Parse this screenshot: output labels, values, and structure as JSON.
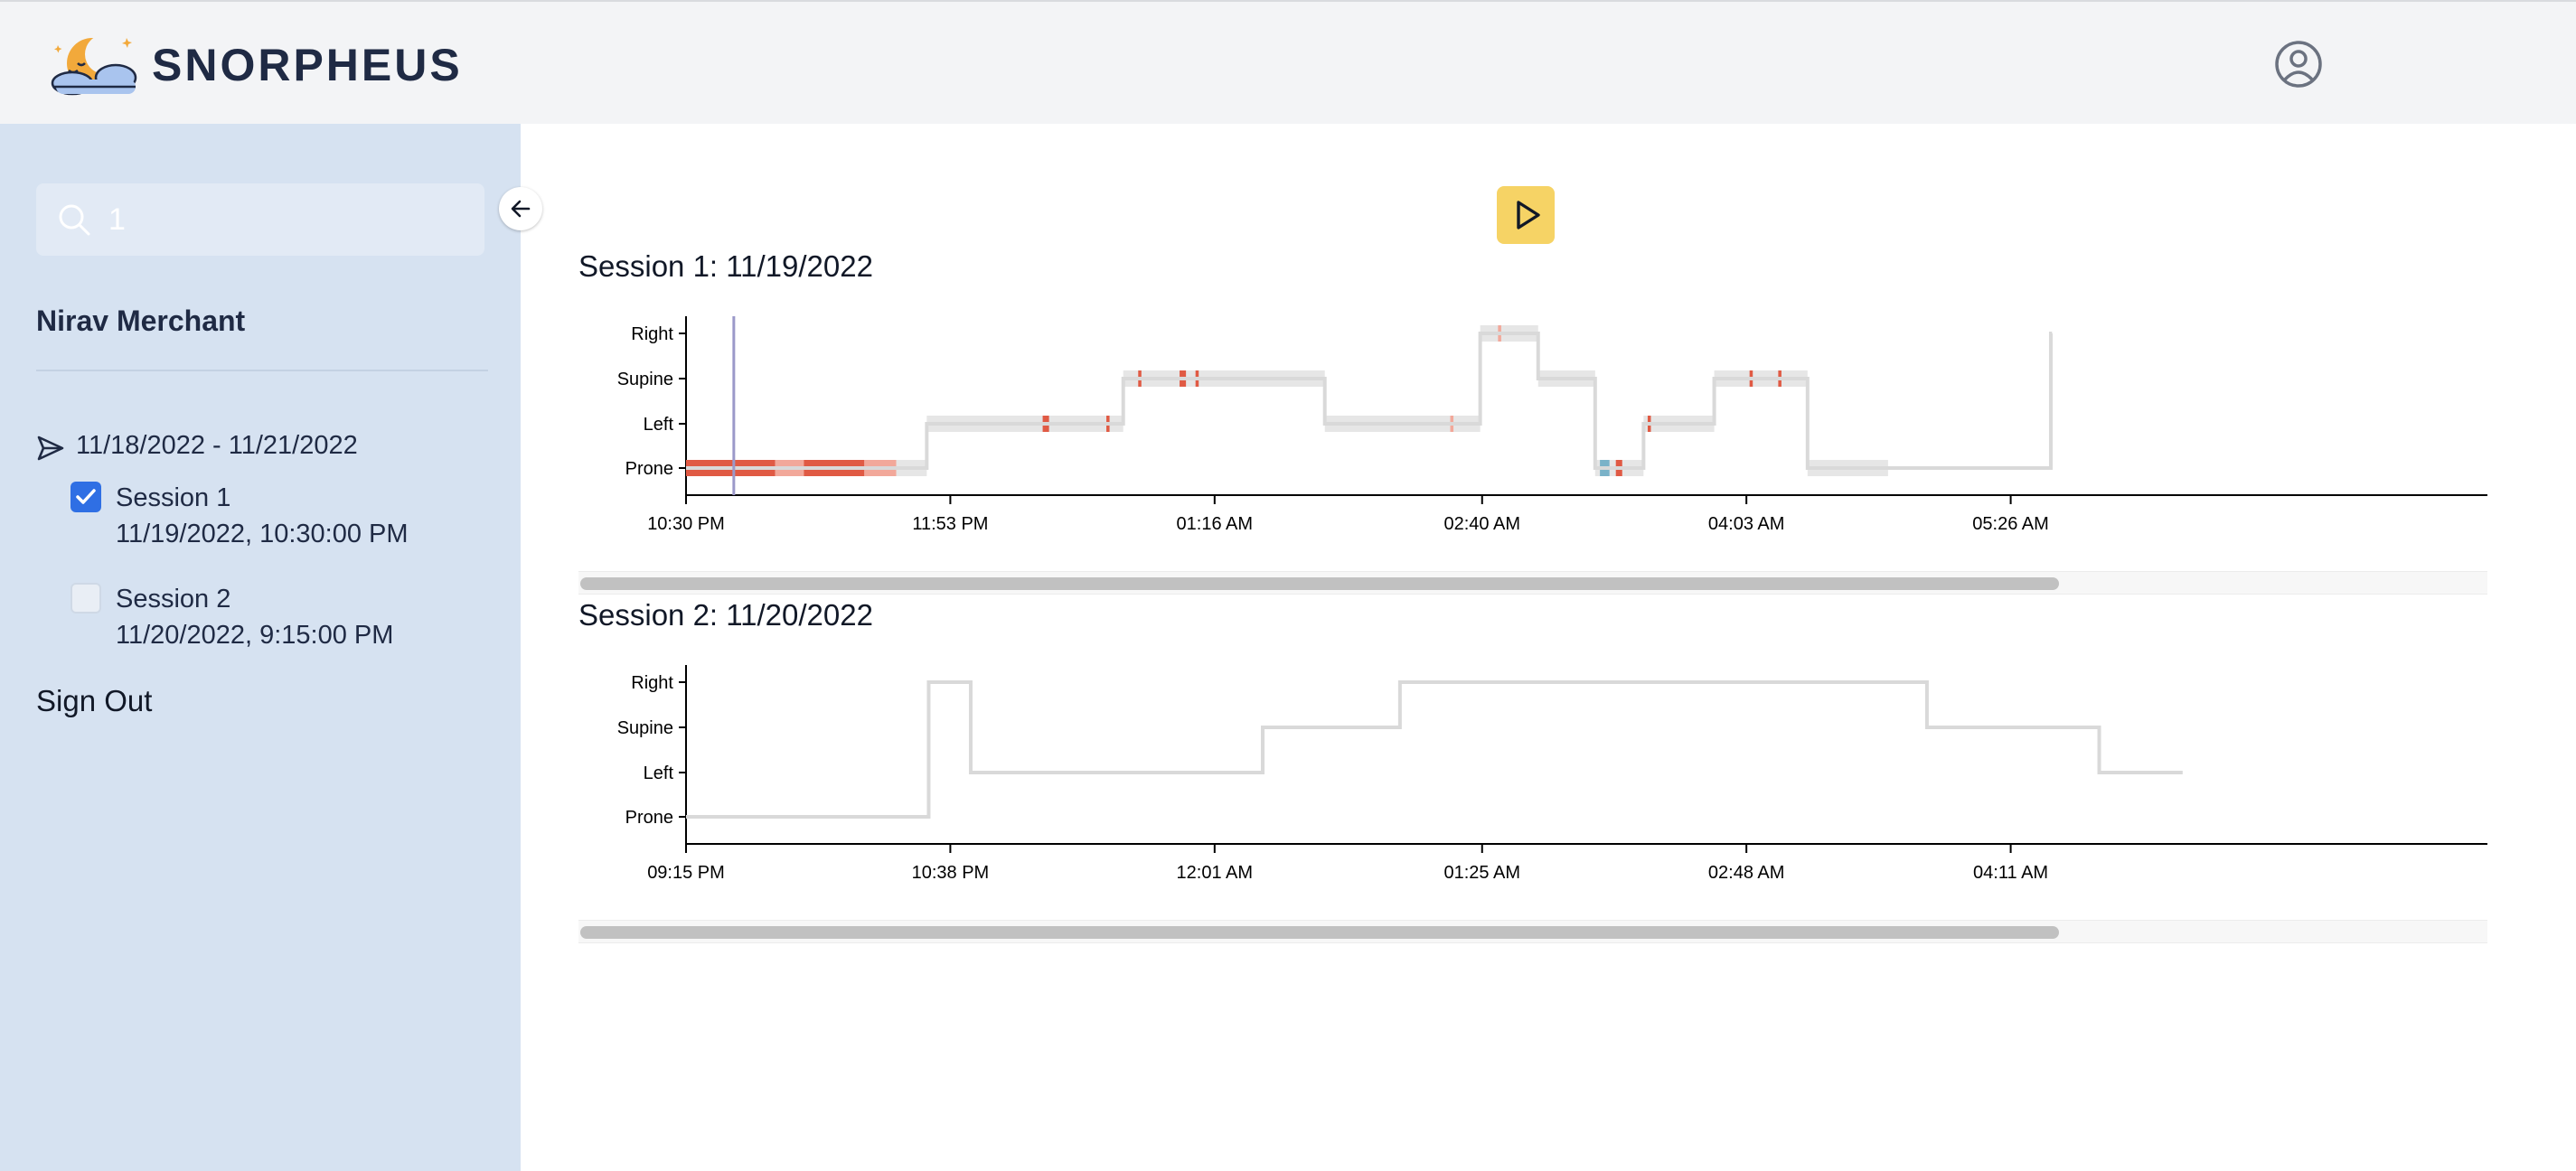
{
  "app": {
    "brand": "SNORPHEUS"
  },
  "header": {
    "logo_icon": "moon-cloud-logo-icon",
    "user_icon": "user-circle-icon"
  },
  "sidebar": {
    "search": {
      "value": "1",
      "icon": "search-icon"
    },
    "collapse_icon": "arrow-left-icon",
    "user_name": "Nirav Merchant",
    "date_range": {
      "label": "11/18/2022 - 11/21/2022",
      "icon": "send-icon"
    },
    "sessions": [
      {
        "title": "Session 1",
        "datetime": "11/19/2022, 10:30:00 PM",
        "checked": true
      },
      {
        "title": "Session 2",
        "datetime": "11/20/2022, 9:15:00 PM",
        "checked": false
      }
    ],
    "sign_out": "Sign Out"
  },
  "player": {
    "play_icon": "play-icon",
    "accent": "#f6d365"
  },
  "colors": {
    "line": "#d9d9d9",
    "band": "#e6e6e6",
    "mark": "#e05a44",
    "mark_light": "#f2a89a",
    "mark_blue": "#7ab2c8",
    "cursor": "#9b99c9"
  },
  "chart_data": [
    {
      "type": "line",
      "title": "Session 1: 11/19/2022",
      "y_categories": [
        "Prone",
        "Left",
        "Supine",
        "Right"
      ],
      "x_tick_labels": [
        "10:30 PM",
        "11:53 PM",
        "01:16 AM",
        "02:40 AM",
        "04:03 AM",
        "05:26 AM"
      ],
      "x_ticks_minutes": [
        0,
        83,
        166,
        250,
        333,
        416
      ],
      "playhead_minute": 15,
      "series": [
        {
          "position_steps": [
            {
              "start": 0,
              "end": 75.6,
              "position": "Prone"
            },
            {
              "start": 75.6,
              "end": 137.3,
              "position": "Left"
            },
            {
              "start": 137.3,
              "end": 200.6,
              "position": "Supine"
            },
            {
              "start": 200.6,
              "end": 249.4,
              "position": "Left"
            },
            {
              "start": 249.4,
              "end": 267.6,
              "position": "Right"
            },
            {
              "start": 267.6,
              "end": 285.5,
              "position": "Supine"
            },
            {
              "start": 285.5,
              "end": 300.7,
              "position": "Prone"
            },
            {
              "start": 300.7,
              "end": 322.9,
              "position": "Left"
            },
            {
              "start": 322.9,
              "end": 352.2,
              "position": "Supine"
            },
            {
              "start": 352.2,
              "end": 428.6,
              "position": "Prone"
            },
            {
              "start": 428.6,
              "end": 429.0,
              "position": "Right"
            }
          ],
          "recorded_bands": [
            {
              "start": 0,
              "end": 75.6,
              "position": "Prone"
            },
            {
              "start": 75.6,
              "end": 137.3,
              "position": "Left"
            },
            {
              "start": 137.3,
              "end": 200.6,
              "position": "Supine"
            },
            {
              "start": 200.6,
              "end": 249.4,
              "position": "Left"
            },
            {
              "start": 249.4,
              "end": 267.6,
              "position": "Right"
            },
            {
              "start": 267.6,
              "end": 285.5,
              "position": "Supine"
            },
            {
              "start": 285.5,
              "end": 300.7,
              "position": "Prone"
            },
            {
              "start": 300.7,
              "end": 322.9,
              "position": "Left"
            },
            {
              "start": 322.9,
              "end": 352.2,
              "position": "Supine"
            },
            {
              "start": 352.2,
              "end": 377.5,
              "position": "Prone"
            }
          ],
          "event_marks": [
            {
              "start": 0,
              "end": 28,
              "position": "Prone",
              "tone": "strong"
            },
            {
              "start": 28,
              "end": 37,
              "position": "Prone",
              "tone": "light"
            },
            {
              "start": 37,
              "end": 56,
              "position": "Prone",
              "tone": "strong"
            },
            {
              "start": 56,
              "end": 66,
              "position": "Prone",
              "tone": "light"
            },
            {
              "start": 112,
              "end": 114,
              "position": "Left",
              "tone": "strong"
            },
            {
              "start": 132,
              "end": 133,
              "position": "Left",
              "tone": "strong"
            },
            {
              "start": 142,
              "end": 143,
              "position": "Supine",
              "tone": "strong"
            },
            {
              "start": 155,
              "end": 157,
              "position": "Supine",
              "tone": "strong"
            },
            {
              "start": 160,
              "end": 161,
              "position": "Supine",
              "tone": "strong"
            },
            {
              "start": 240,
              "end": 241,
              "position": "Left",
              "tone": "light"
            },
            {
              "start": 255,
              "end": 256,
              "position": "Right",
              "tone": "light"
            },
            {
              "start": 287,
              "end": 290,
              "position": "Prone",
              "tone": "blue"
            },
            {
              "start": 292,
              "end": 294,
              "position": "Prone",
              "tone": "strong"
            },
            {
              "start": 302,
              "end": 303,
              "position": "Left",
              "tone": "strong"
            },
            {
              "start": 334,
              "end": 335,
              "position": "Supine",
              "tone": "strong"
            },
            {
              "start": 343,
              "end": 344,
              "position": "Supine",
              "tone": "strong"
            }
          ]
        }
      ]
    },
    {
      "type": "line",
      "title": "Session 2: 11/20/2022",
      "y_categories": [
        "Prone",
        "Left",
        "Supine",
        "Right"
      ],
      "x_tick_labels": [
        "09:15 PM",
        "10:38 PM",
        "12:01 AM",
        "01:25 AM",
        "02:48 AM",
        "04:11 AM"
      ],
      "x_ticks_minutes": [
        0,
        83,
        166,
        250,
        333,
        416
      ],
      "series": [
        {
          "position_steps": [
            {
              "start": 0,
              "end": 76.2,
              "position": "Prone"
            },
            {
              "start": 76.2,
              "end": 89.4,
              "position": "Right"
            },
            {
              "start": 89.4,
              "end": 181.1,
              "position": "Left"
            },
            {
              "start": 181.1,
              "end": 224.2,
              "position": "Supine"
            },
            {
              "start": 224.2,
              "end": 389.7,
              "position": "Right"
            },
            {
              "start": 389.7,
              "end": 443.8,
              "position": "Supine"
            },
            {
              "start": 443.8,
              "end": 470.0,
              "position": "Left"
            }
          ]
        }
      ]
    }
  ]
}
